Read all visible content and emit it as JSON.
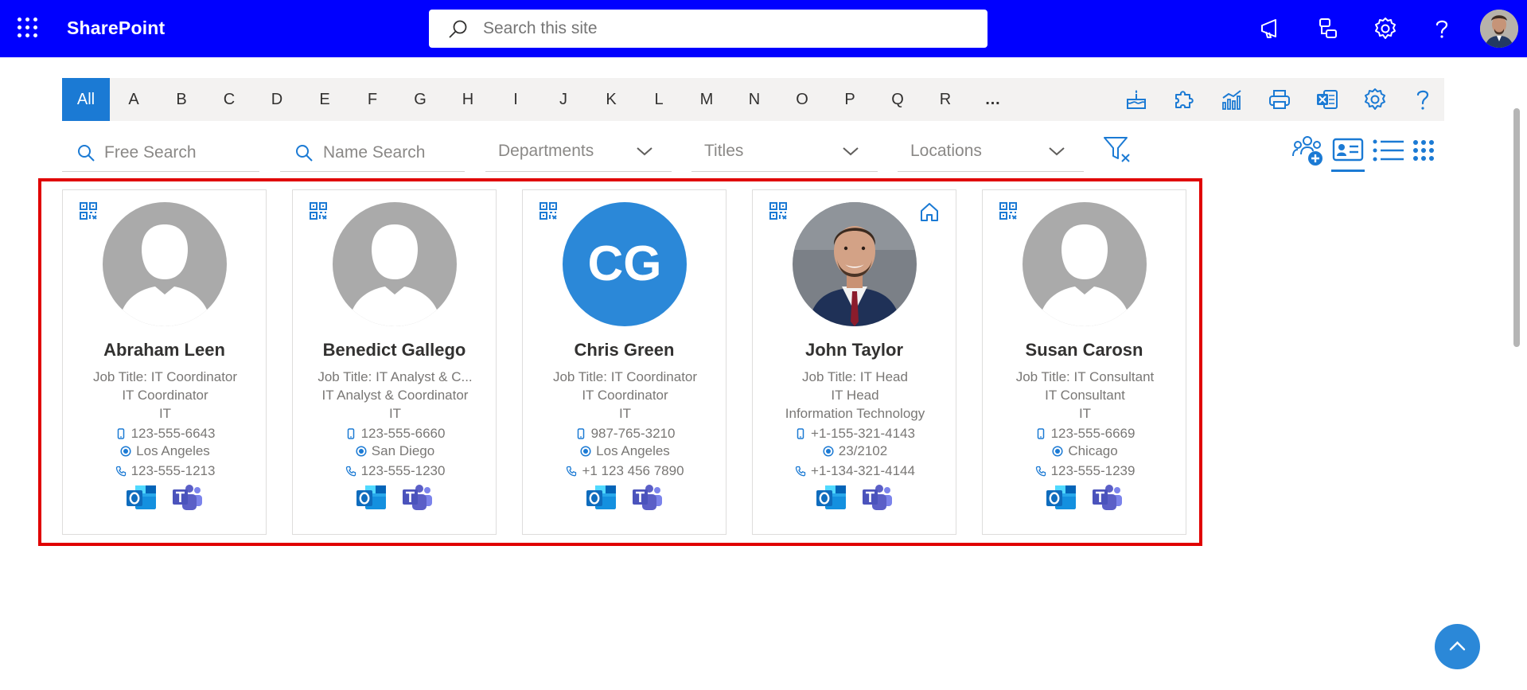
{
  "app": {
    "brand": "SharePoint"
  },
  "search": {
    "placeholder": "Search this site"
  },
  "topbar_icons": [
    "megaphone-icon",
    "network-icon",
    "gear-icon",
    "help-icon"
  ],
  "alphabet": [
    "All",
    "A",
    "B",
    "C",
    "D",
    "E",
    "F",
    "G",
    "H",
    "I",
    "J",
    "K",
    "L",
    "M",
    "N",
    "O",
    "P",
    "Q",
    "R",
    "…"
  ],
  "active_letter": "All",
  "toolbar_icons": [
    "birthday-cake-icon",
    "puzzle-icon",
    "analytics-icon",
    "print-icon",
    "excel-icon",
    "settings-icon",
    "help-icon"
  ],
  "filters": {
    "free_search": "Free Search",
    "name_search": "Name Search",
    "departments": "Departments",
    "titles": "Titles",
    "locations": "Locations"
  },
  "view_icons": [
    "add-people-icon",
    "card-view-icon",
    "list-view-icon",
    "grid-view-icon"
  ],
  "cards": [
    {
      "name": "Abraham Leen",
      "job_title_line": "Job Title: IT Coordinator",
      "title": "IT Coordinator",
      "department": "IT",
      "mobile": "123-555-6643",
      "location": "Los Angeles",
      "phone": "123-555-1213",
      "photo": "placeholder"
    },
    {
      "name": "Benedict Gallego",
      "job_title_line": "Job Title: IT Analyst & C...",
      "title": "IT Analyst & Coordinator",
      "department": "IT",
      "mobile": "123-555-6660",
      "location": "San Diego",
      "phone": "123-555-1230",
      "photo": "placeholder"
    },
    {
      "name": "Chris Green",
      "job_title_line": "Job Title: IT Coordinator",
      "title": "IT Coordinator",
      "department": "IT",
      "mobile": "987-765-3210",
      "location": "Los Angeles",
      "phone": "+1 123 456 7890",
      "photo": "initials",
      "initials": "CG"
    },
    {
      "name": "John Taylor",
      "job_title_line": "Job Title: IT Head",
      "title": "IT Head",
      "department": "Information Technology",
      "mobile": "+1-155-321-4143",
      "location": "23/2102",
      "phone": "+1-134-321-4144",
      "photo": "portrait"
    },
    {
      "name": "Susan Carosn",
      "job_title_line": "Job Title: IT Consultant",
      "title": "IT Consultant",
      "department": "IT",
      "mobile": "123-555-6669",
      "location": "Chicago",
      "phone": "123-555-1239",
      "photo": "placeholder"
    }
  ],
  "colors": {
    "topbar": "#0000ff",
    "accent": "#1b7ad4",
    "highlight": "#e00000",
    "outlook": "#0f6cbd",
    "teams": "#5b5fc7"
  }
}
